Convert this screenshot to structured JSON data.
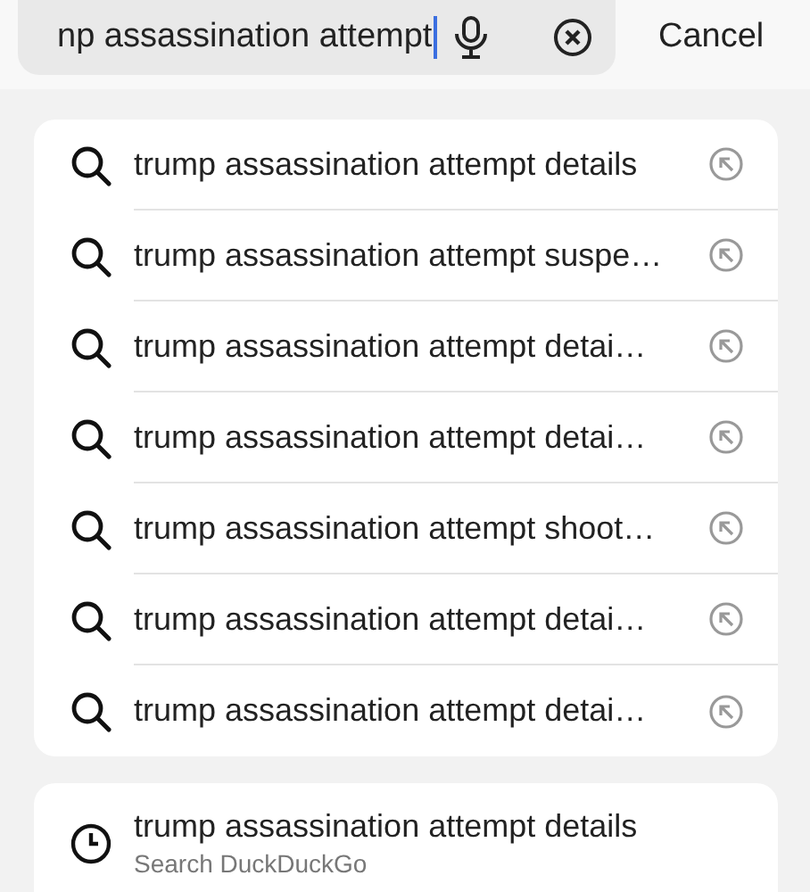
{
  "search": {
    "value": "np assassination attempt",
    "cancel": "Cancel"
  },
  "suggestions": [
    {
      "text": "trump assassination attempt details"
    },
    {
      "text": "trump assassination attempt suspe…"
    },
    {
      "text": "trump assassination attempt detai…"
    },
    {
      "text": "trump assassination attempt detai…"
    },
    {
      "text": "trump assassination attempt shoot…"
    },
    {
      "text": "trump assassination attempt detai…"
    },
    {
      "text": "trump assassination attempt detai…"
    }
  ],
  "history": [
    {
      "title": "trump assassination attempt details",
      "subtitle": "Search DuckDuckGo"
    }
  ]
}
